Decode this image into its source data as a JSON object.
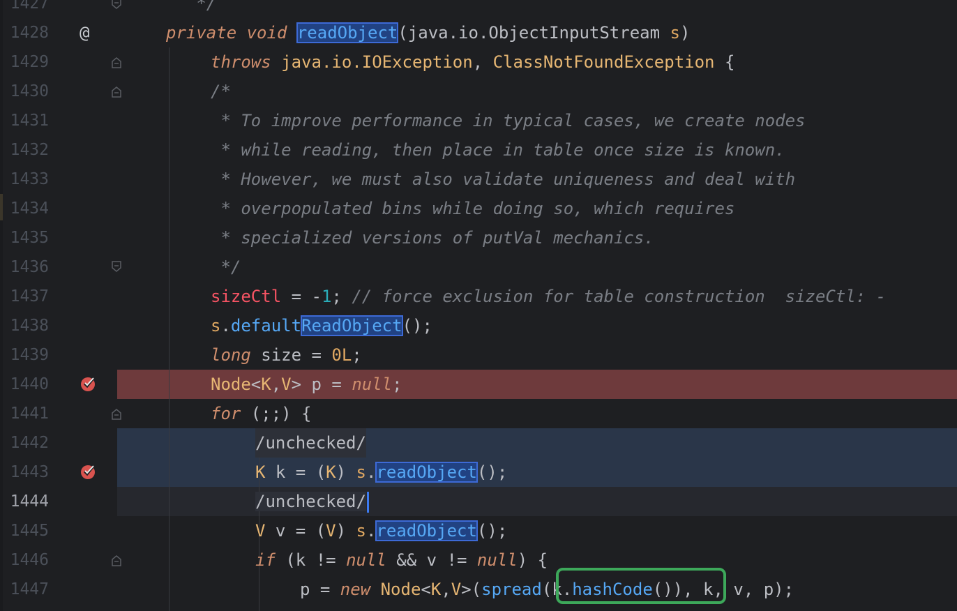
{
  "editor": {
    "lines": [
      {
        "n": "1427",
        "text": "   */"
      },
      {
        "n": "1428",
        "text": "private void readObject(java.io.ObjectInputStream s)"
      },
      {
        "n": "1429",
        "text": "throws java.io.IOException, ClassNotFoundException {"
      },
      {
        "n": "1430",
        "text": "/*"
      },
      {
        "n": "1431",
        "text": " * To improve performance in typical cases, we create nodes"
      },
      {
        "n": "1432",
        "text": " * while reading, then place in table once size is known."
      },
      {
        "n": "1433",
        "text": " * However, we must also validate uniqueness and deal with"
      },
      {
        "n": "1434",
        "text": " * overpopulated bins while doing so, which requires"
      },
      {
        "n": "1435",
        "text": " * specialized versions of putVal mechanics."
      },
      {
        "n": "1436",
        "text": " */"
      },
      {
        "n": "1437",
        "text": "sizeCtl = -1; // force exclusion for table construction  sizeCtl: -"
      },
      {
        "n": "1438",
        "text": "s.defaultReadObject();"
      },
      {
        "n": "1439",
        "text": "long size = 0L;"
      },
      {
        "n": "1440",
        "text": "Node<K,V> p = null;"
      },
      {
        "n": "1441",
        "text": "for (;;) {"
      },
      {
        "n": "1442",
        "text": "/unchecked/"
      },
      {
        "n": "1443",
        "text": "K k = (K) s.readObject();"
      },
      {
        "n": "1444",
        "text": "/unchecked/"
      },
      {
        "n": "1445",
        "text": "V v = (V) s.readObject();"
      },
      {
        "n": "1446",
        "text": "if (k != null && v != null) {"
      },
      {
        "n": "1447",
        "text": "p = new Node<K,V>(spread(k.hashCode()), k, v, p);"
      }
    ],
    "gutter_at_symbol": "@",
    "colors": {
      "background": "#1e1f22",
      "breakpoint_line": "#6e3a3c",
      "selection_line": "#2a3649",
      "highlight_box": "#3d6ad6",
      "callout_box": "#3da85a",
      "breakpoint_icon": "#d9534f"
    }
  }
}
